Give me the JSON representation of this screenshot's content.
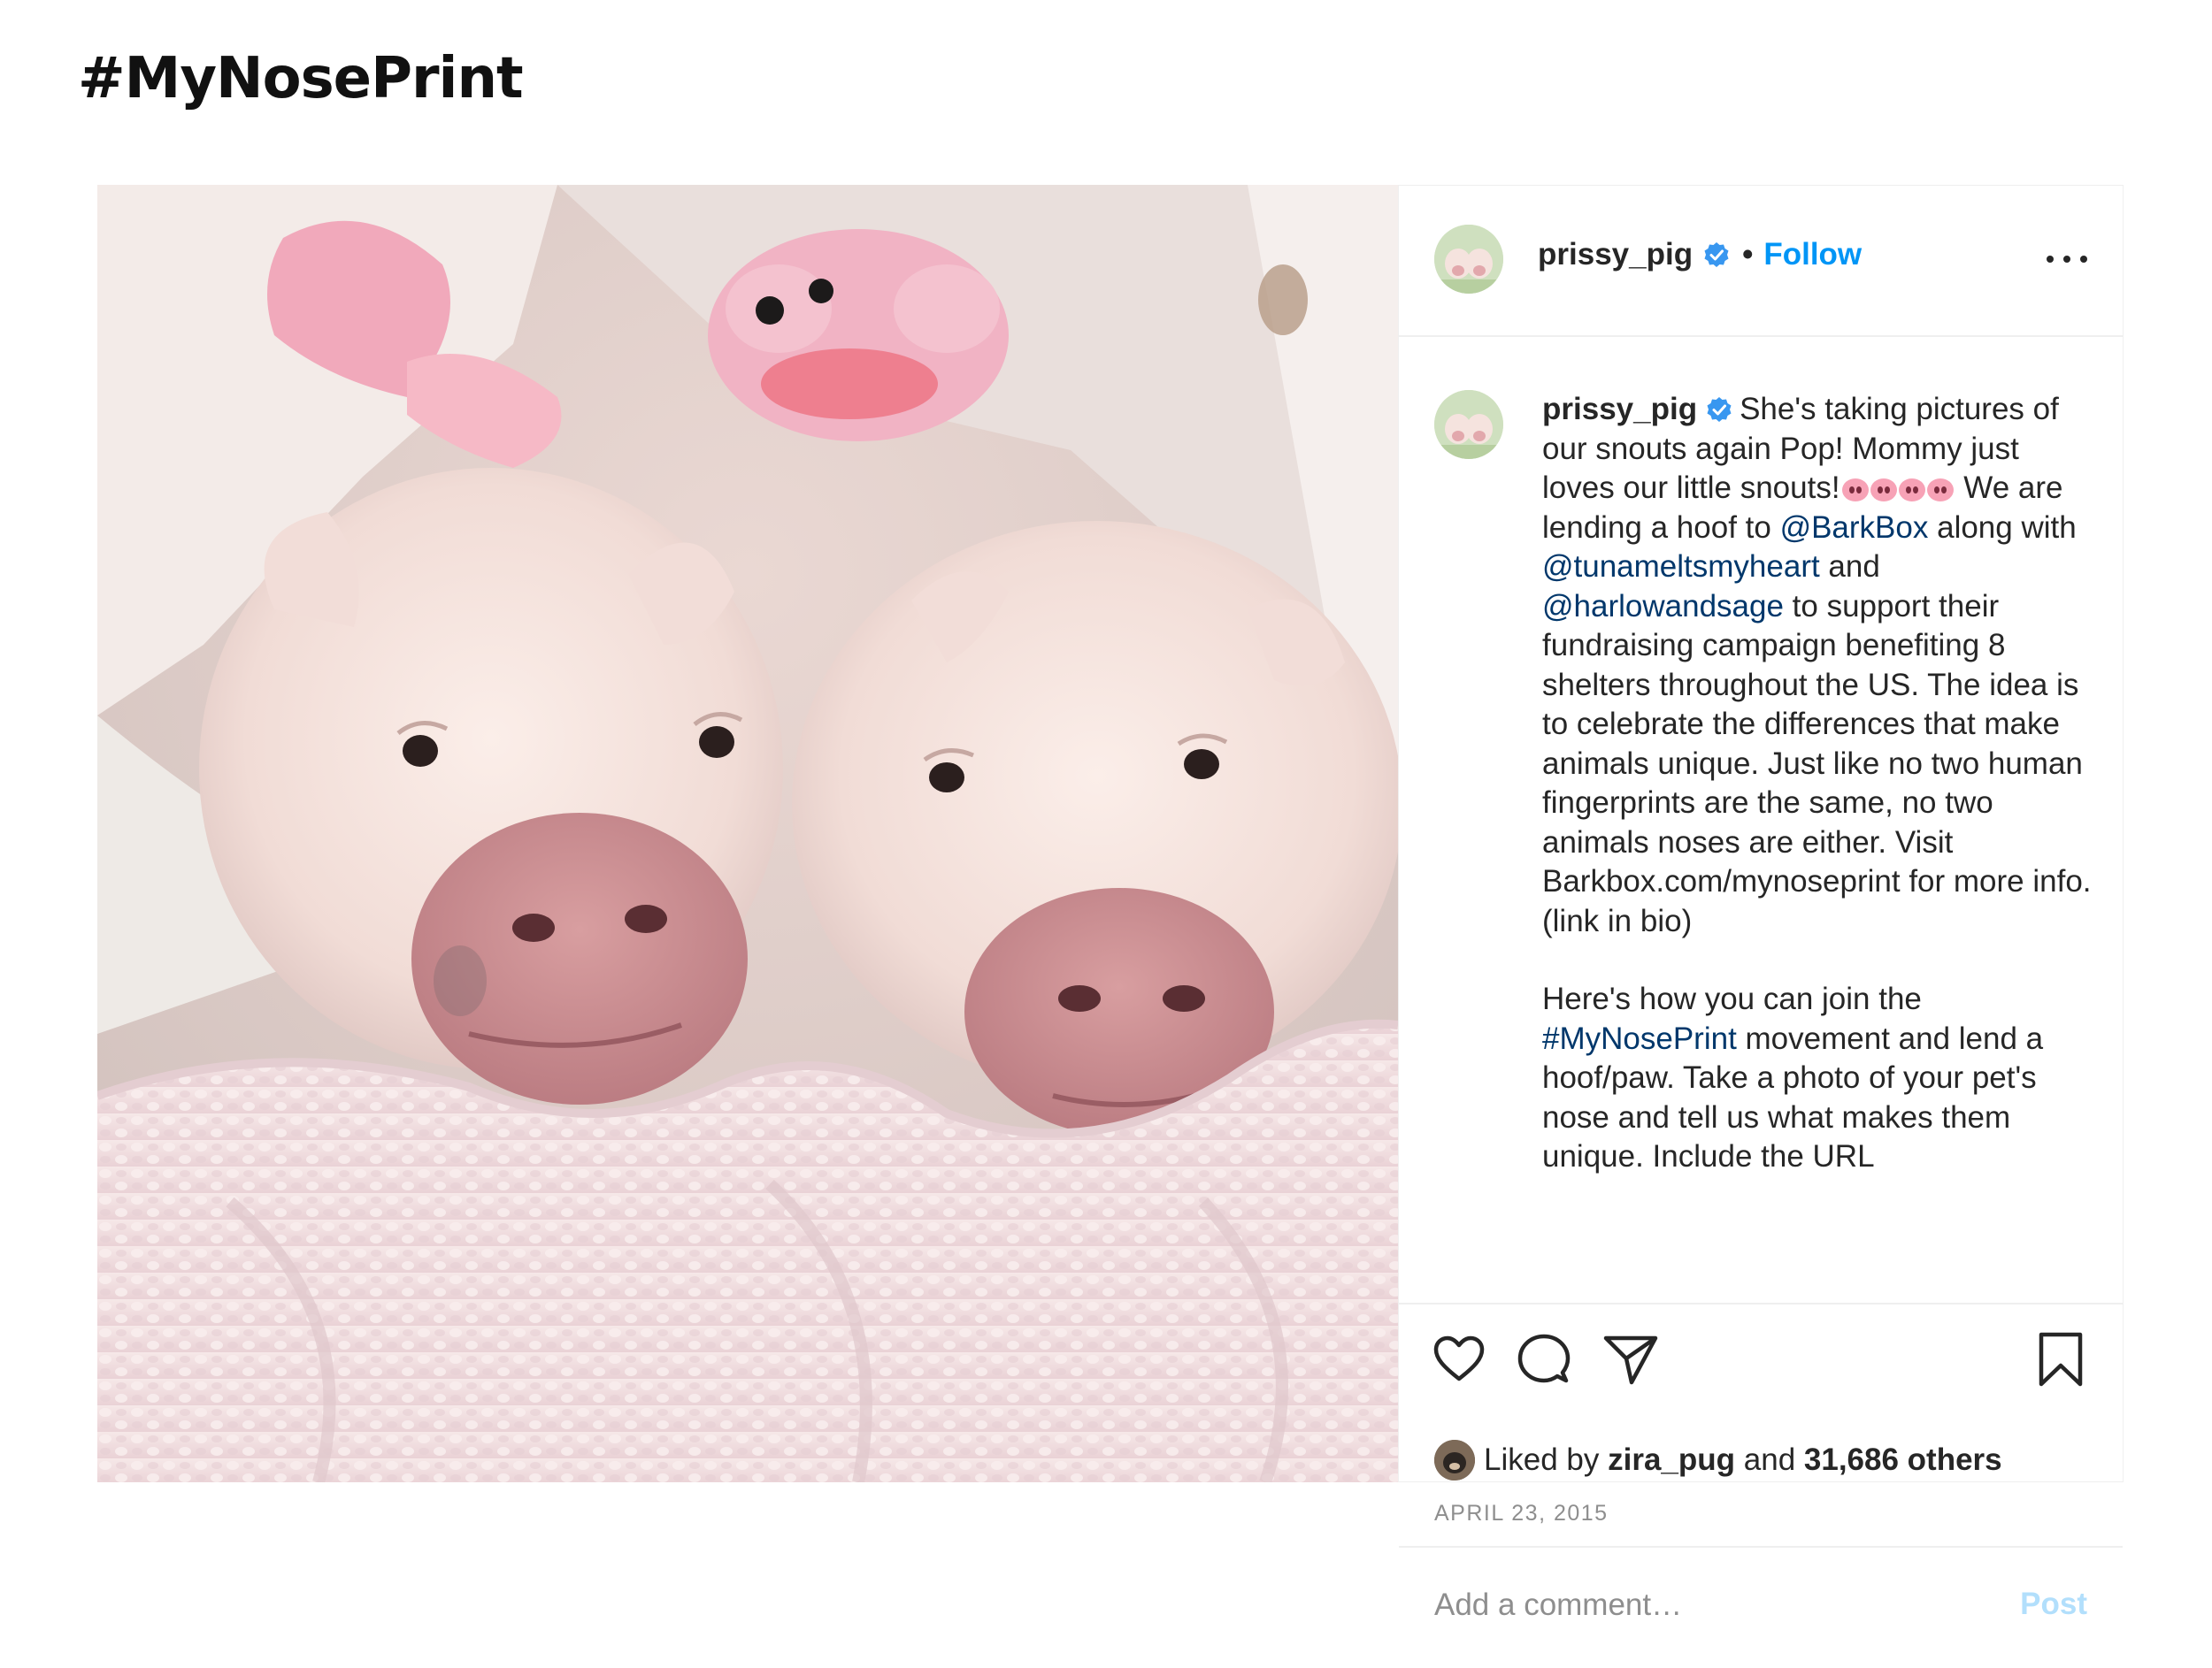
{
  "page": {
    "heading": "#MyNosePrint"
  },
  "post": {
    "author": {
      "username": "prissy_pig",
      "verified": true
    },
    "follow_label": "Follow",
    "header_separator": "•",
    "caption": {
      "username": "prissy_pig",
      "p1_a": "She's taking pictures of our snouts again Pop! Mommy just loves our little snouts!",
      "p1_emoji": "pig-nose emoji ×4",
      "p1_b": " We are lending a hoof to ",
      "mention_1": "@BarkBox",
      "p1_c": " along with ",
      "mention_2": "@tunameltsmyheart",
      "p1_d": " and ",
      "mention_3": "@harlowandsage",
      "p1_e": " to support their fundraising campaign benefiting 8 shelters throughout the US. The idea is to celebrate the differences that make animals unique. Just like no two human fingerprints are the same, no two animals noses are either. Visit Barkbox.com/mynoseprint for more info.(link in bio)",
      "p2_a": "Here's how you can join the ",
      "hashtag": "#MyNosePrint",
      "p2_b": " movement and lend a hoof/paw. Take a photo of your pet's nose and tell us what makes them unique. Include the URL"
    },
    "likes": {
      "prefix": "Liked by",
      "user": "zira_pug",
      "joiner": "and",
      "others": "31,686 others"
    },
    "date": "APRIL 23, 2015",
    "comment": {
      "placeholder": "Add a comment…",
      "post_label": "Post"
    },
    "colors": {
      "link_blue": "#0095f6",
      "mention": "#00376b",
      "muted": "#8e8e8e",
      "post_disabled": "#b2dffc"
    },
    "icons": [
      "heart-icon",
      "comment-icon",
      "share-icon",
      "bookmark-icon",
      "more-options-icon",
      "verified-badge-icon"
    ]
  }
}
